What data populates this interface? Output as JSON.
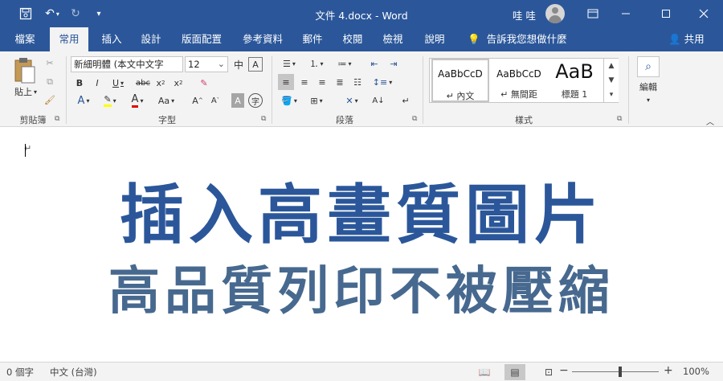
{
  "window": {
    "doc_title": "文件 4.docx  -  Word",
    "user_name": "哇 哇"
  },
  "tabs": [
    "檔案",
    "常用",
    "插入",
    "設計",
    "版面配置",
    "參考資料",
    "郵件",
    "校閱",
    "檢視",
    "說明"
  ],
  "tell_me": "告訴我您想做什麼",
  "share_label": "共用",
  "ribbon": {
    "clipboard": {
      "paste_label": "貼上",
      "group_label": "剪貼簿"
    },
    "font": {
      "font_name": "新細明體 (本文中文字",
      "font_size": "12",
      "group_label": "字型"
    },
    "paragraph": {
      "group_label": "段落"
    },
    "styles": {
      "items": [
        {
          "sample": "AaBbCcD",
          "name": "↵ 內文"
        },
        {
          "sample": "AaBbCcD",
          "name": "↵ 無間距"
        },
        {
          "sample": "AaB",
          "name": "標題 1"
        }
      ],
      "group_label": "樣式"
    },
    "editing": {
      "label": "編輯"
    }
  },
  "document": {
    "headline_1": "插入高畫質圖片",
    "headline_2": "高品質列印不被壓縮",
    "colors": {
      "headline_1": "#2b579a",
      "headline_2": "#47698f"
    }
  },
  "status": {
    "word_count": "0 個字",
    "language": "中文 (台灣)",
    "zoom": "100%"
  },
  "theme": {
    "accent": "#2b579a"
  }
}
